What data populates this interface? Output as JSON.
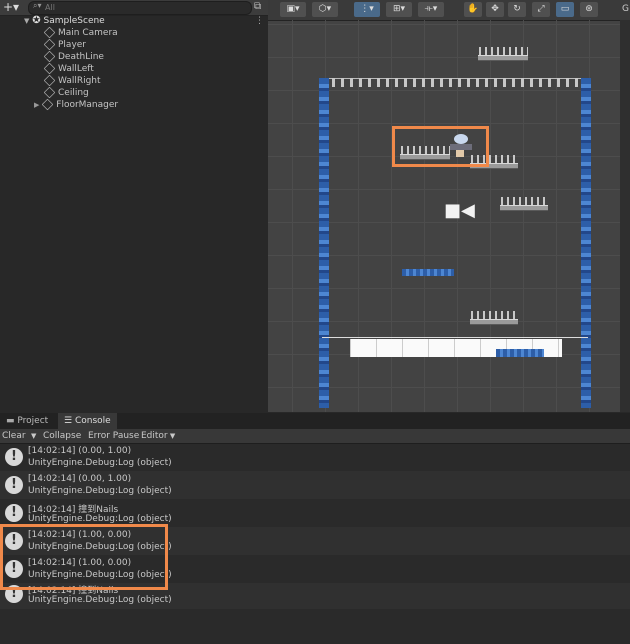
{
  "hierarchy": {
    "search_placeholder": "All",
    "scene_name": "SampleScene",
    "items": [
      {
        "label": "Main Camera"
      },
      {
        "label": "Player"
      },
      {
        "label": "DeathLine"
      },
      {
        "label": "WallLeft"
      },
      {
        "label": "WallRight"
      },
      {
        "label": "Ceiling"
      },
      {
        "label": "FloorManager"
      }
    ]
  },
  "scene": {
    "right_tab_label": "G"
  },
  "bottom_panel": {
    "tabs": [
      {
        "label": "Project"
      },
      {
        "label": "Console"
      }
    ],
    "active_tab": "Console",
    "toolbar": {
      "clear": "Clear",
      "collapse": "Collapse",
      "error_pause": "Error Pause",
      "editor": "Editor"
    },
    "logs": [
      {
        "line1": "[14:02:14] (0.00, 1.00)",
        "line2": "UnityEngine.Debug:Log (object)"
      },
      {
        "line1": "[14:02:14] (0.00, 1.00)",
        "line2": "UnityEngine.Debug:Log (object)"
      },
      {
        "line1": "[14:02:14] 撞到Nails",
        "line2": "UnityEngine.Debug:Log (object)"
      },
      {
        "line1": "[14:02:14] (1.00, 0.00)",
        "line2": "UnityEngine.Debug:Log (object)"
      },
      {
        "line1": "[14:02:14] (1.00, 0.00)",
        "line2": "UnityEngine.Debug:Log (object)"
      },
      {
        "line1": "[14:02:14] 撞到Nails",
        "line2": "UnityEngine.Debug:Log (object)"
      }
    ]
  },
  "colors": {
    "highlight": "#f0894a",
    "wall_blue": "#3b6fbf",
    "selected_tool": "#4a6a8a"
  }
}
